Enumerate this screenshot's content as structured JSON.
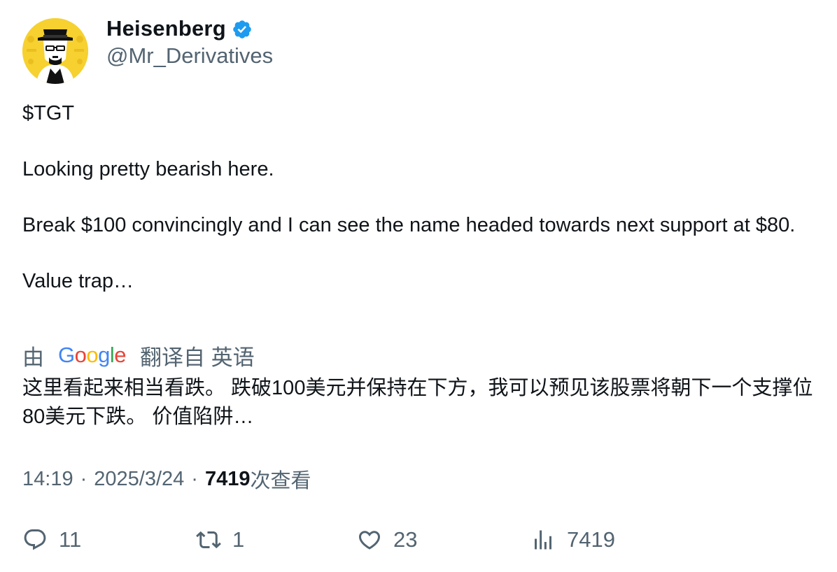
{
  "author": {
    "display_name": "Heisenberg",
    "handle": "@Mr_Derivatives",
    "verified": true,
    "avatar_icon": "heisenberg-avatar",
    "verified_color": "#1d9bf0"
  },
  "tweet": {
    "paragraphs": [
      "$TGT",
      "Looking pretty bearish here.",
      "Break $100 convincingly and I can see the name headed towards next support at $80.",
      "Value trap…"
    ]
  },
  "translation": {
    "prefix": "由",
    "provider": "Google",
    "suffix": "翻译自 英语",
    "text": "这里看起来相当看跌。 跌破100美元并保持在下方，我可以预见该股票将朝下一个支撑位80美元下跌。 价值陷阱…"
  },
  "meta": {
    "time": "14:19",
    "separator": "·",
    "date": "2025/3/24",
    "views_count": "7419",
    "views_label": "次查看"
  },
  "actions": {
    "reply_count": "11",
    "retweet_count": "1",
    "like_count": "23",
    "views_count": "7419"
  },
  "colors": {
    "text": "#0f1419",
    "secondary": "#536471",
    "accent": "#1d9bf0"
  }
}
